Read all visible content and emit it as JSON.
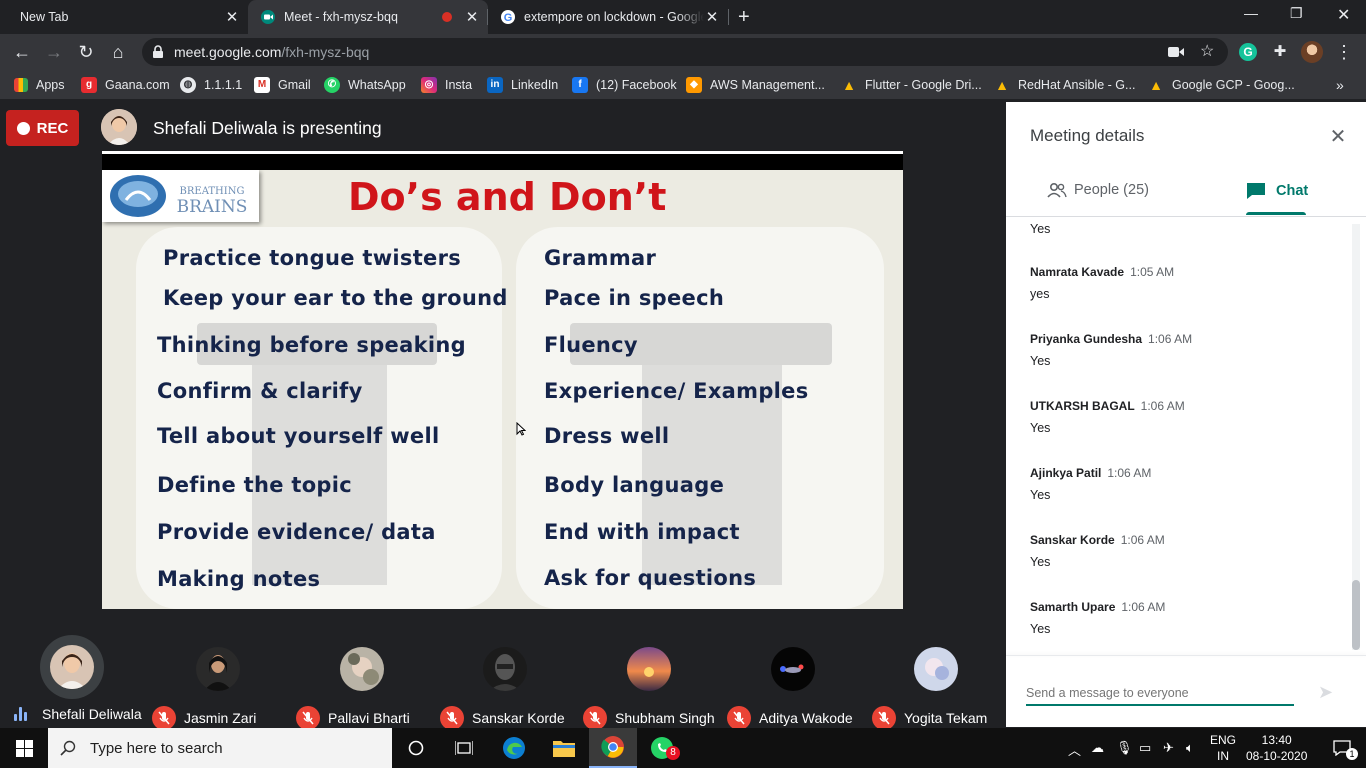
{
  "browser": {
    "tabs": [
      {
        "title": "New Tab"
      },
      {
        "title": "Meet - fxh-mysz-bqq"
      },
      {
        "title": "extempore on lockdown - Google Search"
      }
    ],
    "url_host": "meet.google.com",
    "url_path": "/fxh-mysz-bqq",
    "bookmarks": [
      {
        "label": "Apps",
        "icon": "apps-grid-icon"
      },
      {
        "label": "Gaana.com",
        "icon": "gaana-icon"
      },
      {
        "label": "1.1.1.1",
        "icon": "globe-icon"
      },
      {
        "label": "Gmail",
        "icon": "gmail-icon"
      },
      {
        "label": "WhatsApp",
        "icon": "whatsapp-icon"
      },
      {
        "label": "Insta",
        "icon": "instagram-icon"
      },
      {
        "label": "LinkedIn",
        "icon": "linkedin-icon"
      },
      {
        "label": "(12) Facebook",
        "icon": "facebook-icon"
      },
      {
        "label": "AWS Management...",
        "icon": "aws-icon"
      },
      {
        "label": "Flutter - Google Dri...",
        "icon": "google-drive-icon"
      },
      {
        "label": "RedHat Ansible - G...",
        "icon": "google-drive-icon"
      },
      {
        "label": "Google GCP - Goog...",
        "icon": "google-drive-icon"
      }
    ]
  },
  "meet": {
    "rec_label": "REC",
    "presenting_text": "Shefali Deliwala is presenting",
    "slide": {
      "title": "Do’s and Don’t",
      "logo_text": "BREATHING BRAINS",
      "left_items": [
        "Practice tongue twisters",
        "Keep your ear to the ground",
        "Thinking before speaking",
        "Confirm & clarify",
        "Tell about yourself well",
        "Define the topic",
        "Provide evidence/ data",
        "Making notes"
      ],
      "right_items": [
        "Grammar",
        "Pace in speech",
        "Fluency",
        "Experience/ Examples",
        "Dress well",
        "Body language",
        "End with impact",
        "Ask for questions"
      ]
    },
    "panel": {
      "title": "Meeting details",
      "people_tab": "People (25)",
      "chat_tab": "Chat",
      "partial_message_text": "Yes",
      "messages": [
        {
          "sender": "Namrata Kavade",
          "time": "1:05 AM",
          "text": "yes"
        },
        {
          "sender": "Priyanka Gundesha",
          "time": "1:06 AM",
          "text": "Yes"
        },
        {
          "sender": "UTKARSH BAGAL",
          "time": "1:06 AM",
          "text": "Yes"
        },
        {
          "sender": "Ajinkya Patil",
          "time": "1:06 AM",
          "text": "Yes"
        },
        {
          "sender": "Sanskar Korde",
          "time": "1:06 AM",
          "text": "Yes"
        },
        {
          "sender": "Samarth Upare",
          "time": "1:06 AM",
          "text": "Yes"
        }
      ],
      "compose_placeholder": "Send a message to everyone"
    },
    "participants": [
      {
        "name": "Shefali Deliwala",
        "muted": false
      },
      {
        "name": "Jasmin Zari",
        "muted": true
      },
      {
        "name": "Pallavi Bharti",
        "muted": true
      },
      {
        "name": "Sanskar Korde",
        "muted": true
      },
      {
        "name": "Shubham Singh",
        "muted": true
      },
      {
        "name": "Aditya Wakode",
        "muted": true
      },
      {
        "name": "Yogita Tekam",
        "muted": true
      }
    ]
  },
  "taskbar": {
    "search_placeholder": "Type here to search",
    "whatsapp_badge": "8",
    "lang_top": "ENG",
    "lang_bottom": "IN",
    "time": "13:40",
    "date": "08-10-2020",
    "notification_count": "1"
  },
  "colors": {
    "rec_red": "#c5221f",
    "meet_teal": "#00796b",
    "slide_title_red": "#d0151a",
    "slide_text_navy": "#15244a",
    "mute_red": "#ea4335"
  }
}
